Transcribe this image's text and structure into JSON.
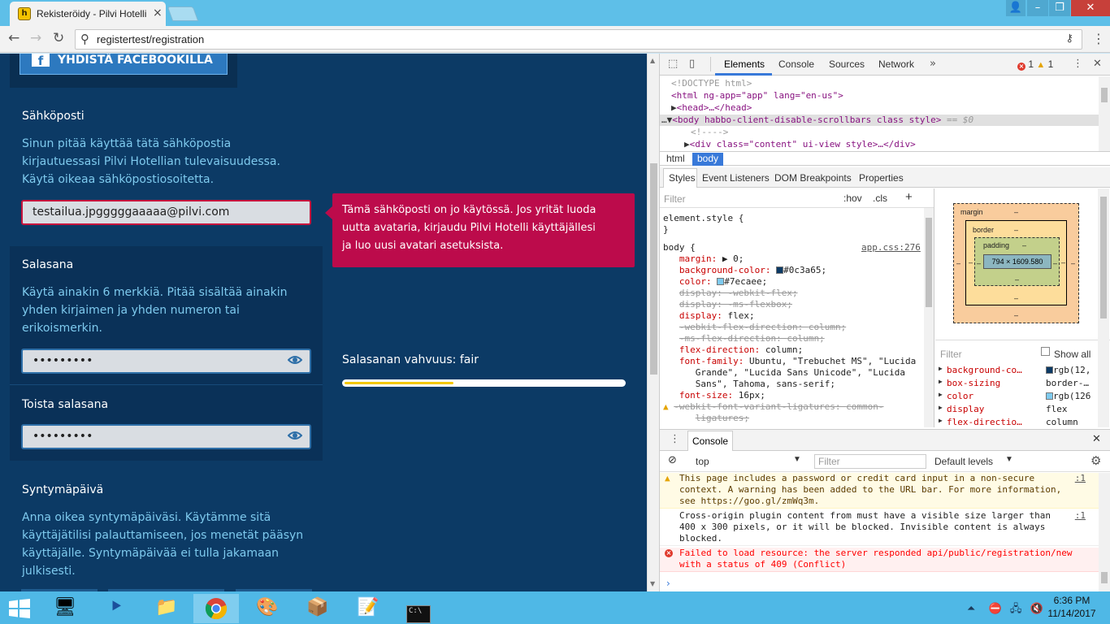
{
  "browser": {
    "tab_title": "Rekisteröidy - Pilvi Hotelli",
    "tab_favicon_glyph": "h",
    "url": "registertest/registration"
  },
  "page": {
    "facebook_button_label": "YHDISTÄ FACEBOOKILLA",
    "email": {
      "title": "Sähköposti",
      "description_lines": [
        "Sinun pitää käyttää tätä sähköpostia",
        "kirjautuessasi Pilvi Hotellian tulevaisuudessa.",
        "Käytä oikeaa sähköpostiosoitetta."
      ],
      "value": "testailua.jpgggggaaaaa@pilvi.com",
      "error_lines": [
        "Tämä sähköposti on jo käytössä. Jos yrität luoda",
        "uutta avataria, kirjaudu Pilvi Hotelli käyttäjällesi",
        "ja luo uusi avatari asetuksista."
      ]
    },
    "password": {
      "title": "Salasana",
      "description_lines": [
        "Käytä ainakin 6 merkkiä. Pitää sisältää ainakin",
        "yhden kirjaimen ja yhden numeron tai",
        "erikoismerkin."
      ],
      "masked_value": "•••••••••",
      "strength_label": "Salasanan vahvuus: fair",
      "strength_fraction": 0.39
    },
    "password_repeat": {
      "title": "Toista salasana",
      "masked_value": "•••••••••"
    },
    "birthday": {
      "title": "Syntymäpäivä",
      "description_lines": [
        "Anna oikea syntymäpäiväsi. Käytämme sitä",
        "käyttäjätilisi palauttamiseen, jos menetät pääsyn",
        "käyttäjälle. Syntymäpäivää ei tulla jakamaan",
        "julkisesti."
      ]
    },
    "colors": {
      "background": "#0c3a65",
      "text": "#7ecaee",
      "error": "#bc0b4b",
      "strength": "#f5c800"
    }
  },
  "devtools": {
    "tabs": [
      "Elements",
      "Console",
      "Sources",
      "Network"
    ],
    "active_tab": "Elements",
    "error_count": "1",
    "warning_count": "1",
    "dom": {
      "doctype": "<!DOCTYPE html>",
      "html_open": "<html ng-app=\"app\" lang=\"en-us\">",
      "head": "<head>…</head>",
      "body_open": "<body habbo-client-disable-scrollbars class style>",
      "body_suffix": "== $0",
      "comment": "<!---->",
      "div": "<div class=\"content\" ui-view style>…</div>"
    },
    "breadcrumbs": [
      "html",
      "body"
    ],
    "sub_tabs": [
      "Styles",
      "Event Listeners",
      "DOM Breakpoints",
      "Properties"
    ],
    "styles": {
      "filter_placeholder": "Filter",
      "hov": ":hov",
      "cls": ".cls",
      "element_style": "element.style {",
      "close_brace": "}",
      "body_selector": "body {",
      "source": "app.css:276",
      "rules": [
        {
          "prop": "margin",
          "value": "▶ 0;",
          "strike": false
        },
        {
          "prop": "background-color",
          "value": "#0c3a65;",
          "swatch": "#0c3a65",
          "strike": false
        },
        {
          "prop": "color",
          "value": "#7ecaee;",
          "swatch": "#7ecaee",
          "strike": false
        },
        {
          "prop": "display",
          "value": "-webkit-flex;",
          "strike": true
        },
        {
          "prop": "display",
          "value": "-ms-flexbox;",
          "strike": true
        },
        {
          "prop": "display",
          "value": "flex;",
          "strike": false
        },
        {
          "prop": "-webkit-flex-direction",
          "value": "column;",
          "strike": true
        },
        {
          "prop": "-ms-flex-direction",
          "value": "column;",
          "strike": true
        },
        {
          "prop": "flex-direction",
          "value": "column;",
          "strike": false
        },
        {
          "prop": "font-family",
          "value": "Ubuntu, \"Trebuchet MS\", \"Lucida",
          "strike": false
        },
        {
          "prop": "",
          "value": "Grande\", \"Lucida Sans Unicode\", \"Lucida",
          "strike": false
        },
        {
          "prop": "",
          "value": "Sans\", Tahoma, sans-serif;",
          "strike": false
        },
        {
          "prop": "font-size",
          "value": "16px;",
          "strike": false
        },
        {
          "prop": "-webkit-font-variant-ligatures",
          "value": "common-",
          "strike": true,
          "warn": true
        },
        {
          "prop": "",
          "value": "ligatures;",
          "strike": true
        }
      ]
    },
    "box_model": {
      "margin_label": "margin",
      "border_label": "border",
      "padding_label": "padding",
      "dash": "–",
      "content_size": "794 × 1609.580"
    },
    "computed": {
      "filter_placeholder": "Filter",
      "show_all": "Show all",
      "rows": [
        {
          "prop": "background-co…",
          "value": "rgb(12,",
          "swatch": "#0c3a65"
        },
        {
          "prop": "box-sizing",
          "value": "border-…"
        },
        {
          "prop": "color",
          "value": "rgb(126",
          "swatch": "#7ecaee"
        },
        {
          "prop": "display",
          "value": "flex"
        },
        {
          "prop": "flex-directio…",
          "value": "column"
        }
      ]
    },
    "console": {
      "tab": "Console",
      "context": "top",
      "filter_placeholder": "Filter",
      "levels": "Default levels",
      "messages": [
        {
          "type": "warn",
          "lines": [
            "This page includes a password or credit card input in a non-secure",
            "context. A warning has been added to the URL bar. For more information,",
            "see https://goo.gl/zmWq3m."
          ],
          "source": ":1"
        },
        {
          "type": "info",
          "lines": [
            "Cross-origin plugin content from  must have a visible size larger than",
            "400 x 300 pixels, or it will be blocked. Invisible content is always",
            "blocked."
          ],
          "source": ":1"
        },
        {
          "type": "err",
          "lines": [
            "Failed to load resource: the server responded  api/public/registration/new",
            "with a status of 409 (Conflict)"
          ],
          "source": ""
        }
      ]
    }
  },
  "taskbar": {
    "time": "6:36 PM",
    "date": "11/14/2017"
  }
}
